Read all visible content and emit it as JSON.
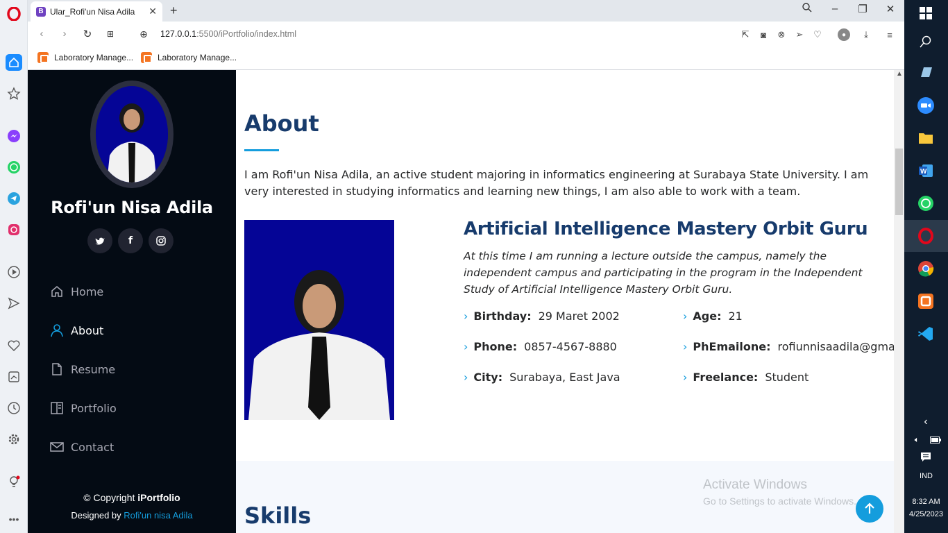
{
  "browser": {
    "tab_title": "Ular_Rofi'un Nisa Adila",
    "tab_favicon": "B",
    "url_host": "127.0.0.1",
    "url_rest": ":5500/iPortfolio/index.html",
    "bookmarks": [
      "Laboratory Manage...",
      "Laboratory Manage..."
    ]
  },
  "sidebar": {
    "name": "Rofi'un Nisa Adila",
    "social": [
      "twitter-icon",
      "facebook-icon",
      "instagram-icon"
    ],
    "nav": [
      {
        "label": "Home",
        "icon": "home-icon"
      },
      {
        "label": "About",
        "icon": "person-icon"
      },
      {
        "label": "Resume",
        "icon": "file-icon"
      },
      {
        "label": "Portfolio",
        "icon": "book-icon"
      },
      {
        "label": "Contact",
        "icon": "envelope-icon"
      }
    ],
    "copyright_prefix": "© Copyright",
    "copyright_brand": "iPortfolio",
    "credits_prefix": "Designed by",
    "credits_name": "Rofi'un nisa Adila"
  },
  "about": {
    "title": "About",
    "description": "I am Rofi'un Nisa Adila, an active student majoring in informatics engineering at Surabaya State University. I am very interested in studying informatics and learning new things, I am also able to work with a team.",
    "job_title": "Artificial Intelligence Mastery Orbit Guru",
    "job_description": "At this time I am running a lecture outside the campus, namely the independent campus and participating in the program in the Independent Study of Artificial Intelligence Mastery Orbit Guru.",
    "info": [
      {
        "label": "Birthday:",
        "value": "29 Maret 2002"
      },
      {
        "label": "Age:",
        "value": "21"
      },
      {
        "label": "Phone:",
        "value": "0857-4567-8880"
      },
      {
        "label": "PhEmailone:",
        "value": "rofiunnisaadila@gmail.c"
      },
      {
        "label": "City:",
        "value": "Surabaya, East Java"
      },
      {
        "label": "Freelance:",
        "value": "Student"
      }
    ]
  },
  "skills": {
    "title": "Skills"
  },
  "watermark": {
    "line1": "Activate Windows",
    "line2": "Go to Settings to activate Windows."
  },
  "tray": {
    "lang": "IND",
    "time": "8:32 AM",
    "date": "4/25/2023"
  },
  "colors": {
    "accent": "#149ddd",
    "heading": "#173b6c",
    "sidebar_bg": "#040b14"
  }
}
